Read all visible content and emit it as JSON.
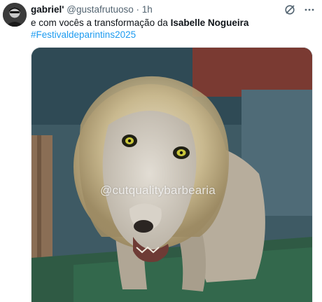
{
  "tweet": {
    "display_name": "gabriel'",
    "handle": "@gustafrutuoso",
    "separator": "·",
    "time": "1h",
    "text_prefix": "e com vocês a transformação da ",
    "text_bold": "Isabelle Nogueira",
    "hashtag": "#Festivaldeparintins2025"
  },
  "media": {
    "watermark": "@cutqualitybarbearia",
    "description_icon": "lion-photo"
  },
  "icons": {
    "grok": "grok-icon",
    "more": "more-icon"
  },
  "colors": {
    "link": "#1d9bf0",
    "secondary_text": "#536471",
    "primary_text": "#0f1419"
  }
}
